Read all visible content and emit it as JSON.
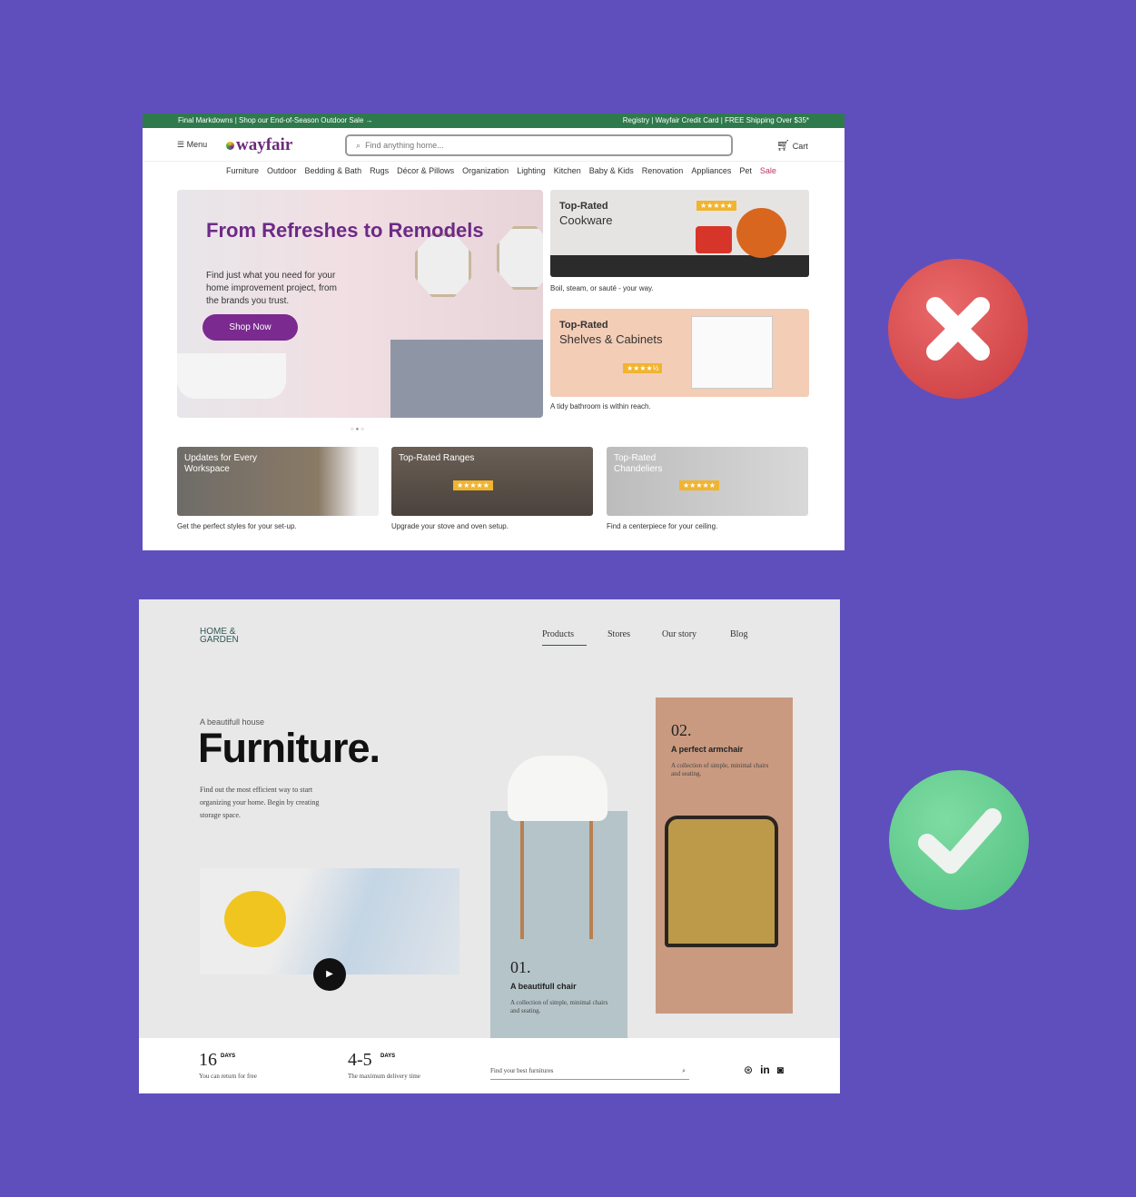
{
  "wayfair": {
    "promo_left": "Final Markdowns | Shop our End-of-Season Outdoor Sale →",
    "promo_right": "Registry | Wayfair Credit Card | FREE Shipping Over $35*",
    "menu_label": "Menu",
    "logo": "wayfair",
    "search_placeholder": "Find anything home...",
    "cart_label": "Cart",
    "nav": [
      "Furniture",
      "Outdoor",
      "Bedding & Bath",
      "Rugs",
      "Décor & Pillows",
      "Organization",
      "Lighting",
      "Kitchen",
      "Baby & Kids",
      "Renovation",
      "Appliances",
      "Pet",
      "Sale"
    ],
    "hero": {
      "title": "From Refreshes to Remodels",
      "body": "Find just what you need for your home improvement project, from the brands you trust.",
      "cta": "Shop Now"
    },
    "cards": [
      {
        "kicker": "Top-Rated",
        "title": "Cookware",
        "stars": "★★★★★",
        "caption": "Boil, steam, or sauté - your way."
      },
      {
        "kicker": "Top-Rated",
        "title": "Shelves & Cabinets",
        "stars": "★★★★½",
        "caption": "A tidy bathroom is within reach."
      }
    ],
    "carousel_dots": "○●○",
    "bottom_cards": [
      {
        "title": "Updates for Every Workspace",
        "caption": "Get the perfect styles for your set-up."
      },
      {
        "title": "Top-Rated Ranges",
        "stars": "★★★★★",
        "caption": "Upgrade your stove and oven setup."
      },
      {
        "title": "Top-Rated Chandeliers",
        "stars": "★★★★★",
        "caption": "Find a centerpiece for your ceiling."
      }
    ]
  },
  "verdicts": {
    "bad_icon": "x-circle-icon",
    "bad_color": "#d9484c",
    "good_icon": "check-circle-icon",
    "good_color": "#5fcb8d"
  },
  "homegarden": {
    "logo": "HOME & GARDEN",
    "nav": [
      "Products",
      "Stores",
      "Our story",
      "Blog"
    ],
    "kicker": "A beautifull house",
    "title": "Furniture.",
    "intro": "Find out the most efficient way to start organizing your home. Begin by creating storage space.",
    "product1": {
      "num": "01.",
      "title": "A beautifull chair",
      "desc": "A collection of simple, minimal chairs and seating."
    },
    "product2": {
      "num": "02.",
      "title": "A perfect armchair",
      "desc": "A collection of simple, minimal chairs and seating."
    },
    "stats": [
      {
        "value": "16",
        "unit": "DAYS",
        "label": "You can return for free"
      },
      {
        "value": "4-5",
        "unit": "DAYS",
        "label": "The maximum delivery time"
      }
    ],
    "search_placeholder": "Find your best furnitures",
    "social": [
      "dribbble-icon",
      "linkedin-icon",
      "instagram-icon"
    ]
  }
}
